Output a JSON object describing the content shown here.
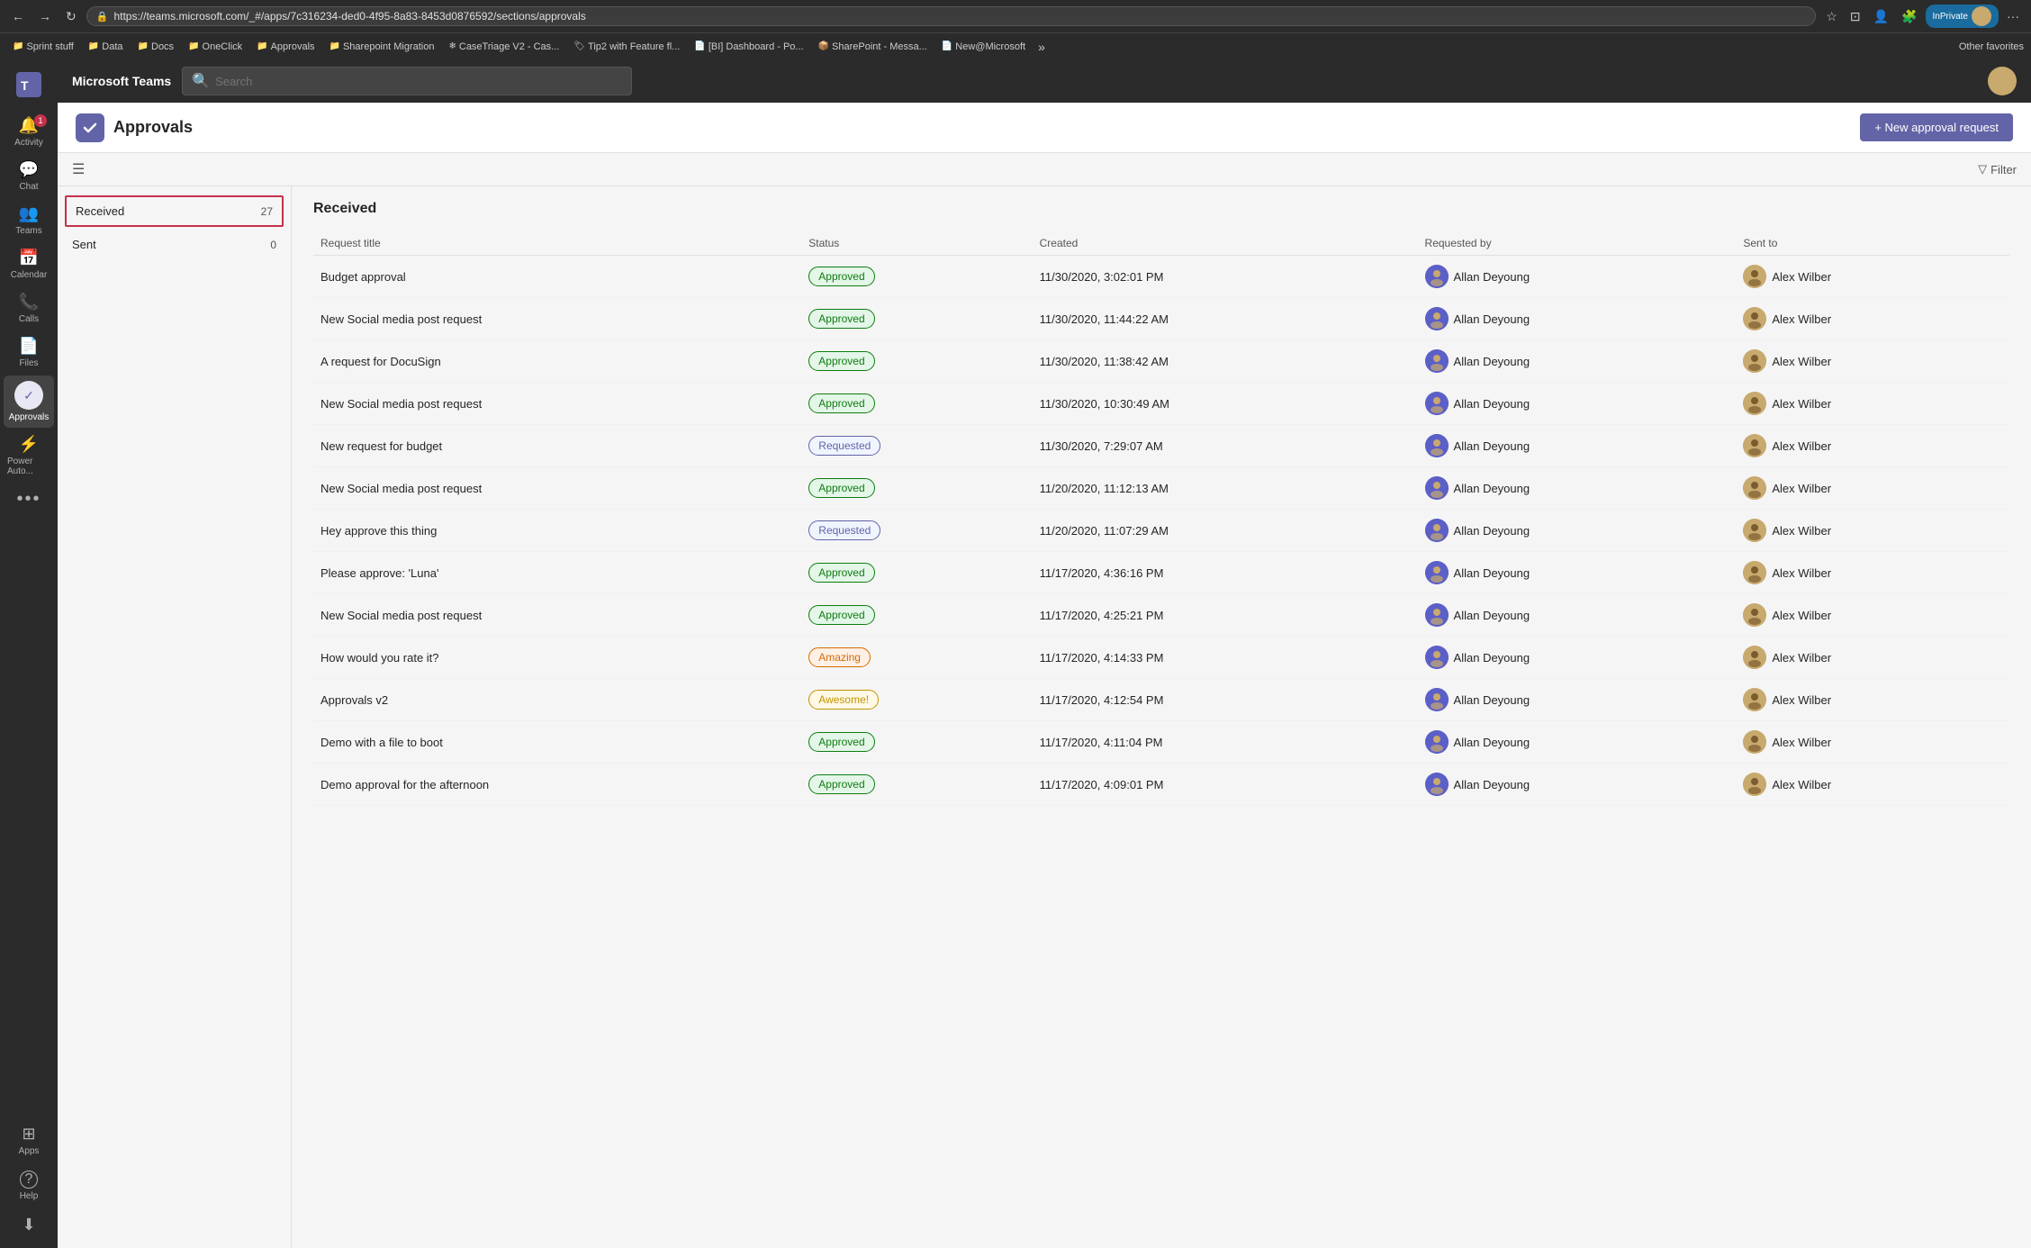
{
  "browser": {
    "url": "https://teams.microsoft.com/_#/apps/7c316234-ded0-4f95-8a83-8453d0876592/sections/approvals",
    "back_btn": "←",
    "forward_btn": "→",
    "refresh_btn": "↻",
    "bookmarks": [
      {
        "label": "Sprint stuff",
        "icon": "📁"
      },
      {
        "label": "Data",
        "icon": "📁"
      },
      {
        "label": "Docs",
        "icon": "📁"
      },
      {
        "label": "OneClick",
        "icon": "📁"
      },
      {
        "label": "Approvals",
        "icon": "📁"
      },
      {
        "label": "Sharepoint Migration",
        "icon": "📁"
      },
      {
        "label": "CaseTriage V2 - Cas...",
        "icon": "❄"
      },
      {
        "label": "Tip2 with Feature fl...",
        "icon": "🏷"
      },
      {
        "label": "[BI] Dashboard - Po...",
        "icon": "📄"
      },
      {
        "label": "SharePoint - Messa...",
        "icon": "📦"
      },
      {
        "label": "New@Microsoft",
        "icon": "📄"
      }
    ],
    "other_favorites": "Other favorites",
    "inprivate_label": "InPrivate"
  },
  "teams": {
    "app_name": "Microsoft Teams",
    "search_placeholder": "Search",
    "sidebar": {
      "items": [
        {
          "id": "activity",
          "label": "Activity",
          "icon": "🔔",
          "badge": "1"
        },
        {
          "id": "chat",
          "label": "Chat",
          "icon": "💬"
        },
        {
          "id": "teams",
          "label": "Teams",
          "icon": "👥"
        },
        {
          "id": "calendar",
          "label": "Calendar",
          "icon": "📅"
        },
        {
          "id": "calls",
          "label": "Calls",
          "icon": "📞"
        },
        {
          "id": "files",
          "label": "Files",
          "icon": "📄"
        },
        {
          "id": "approvals",
          "label": "Approvals",
          "icon": "✓",
          "active": true
        },
        {
          "id": "powerauto",
          "label": "Power Auto...",
          "icon": "⚡"
        },
        {
          "id": "more",
          "label": "...",
          "icon": "···"
        },
        {
          "id": "apps",
          "label": "Apps",
          "icon": "⊞"
        },
        {
          "id": "help",
          "label": "Help",
          "icon": "?"
        }
      ]
    }
  },
  "approvals": {
    "title": "Approvals",
    "new_button_label": "+ New approval request",
    "filter_label": "Filter",
    "section_title": "Received",
    "nav_items": [
      {
        "id": "received",
        "label": "Received",
        "count": "27",
        "active": true
      },
      {
        "id": "sent",
        "label": "Sent",
        "count": "0"
      }
    ],
    "columns": {
      "request_title": "Request title",
      "status": "Status",
      "created": "Created",
      "requested_by": "Requested by",
      "sent_to": "Sent to"
    },
    "rows": [
      {
        "title": "Budget approval",
        "status": "Approved",
        "status_type": "approved",
        "created": "11/30/2020, 3:02:01 PM",
        "requested_by": "Allan Deyoung",
        "sent_to": "Alex Wilber"
      },
      {
        "title": "New Social media post request",
        "status": "Approved",
        "status_type": "approved",
        "created": "11/30/2020, 11:44:22 AM",
        "requested_by": "Allan Deyoung",
        "sent_to": "Alex Wilber"
      },
      {
        "title": "A request for DocuSign",
        "status": "Approved",
        "status_type": "approved",
        "created": "11/30/2020, 11:38:42 AM",
        "requested_by": "Allan Deyoung",
        "sent_to": "Alex Wilber"
      },
      {
        "title": "New Social media post request",
        "status": "Approved",
        "status_type": "approved",
        "created": "11/30/2020, 10:30:49 AM",
        "requested_by": "Allan Deyoung",
        "sent_to": "Alex Wilber"
      },
      {
        "title": "New request for budget",
        "status": "Requested",
        "status_type": "requested",
        "created": "11/30/2020, 7:29:07 AM",
        "requested_by": "Allan Deyoung",
        "sent_to": "Alex Wilber"
      },
      {
        "title": "New Social media post request",
        "status": "Approved",
        "status_type": "approved",
        "created": "11/20/2020, 11:12:13 AM",
        "requested_by": "Allan Deyoung",
        "sent_to": "Alex Wilber"
      },
      {
        "title": "Hey approve this thing",
        "status": "Requested",
        "status_type": "requested",
        "created": "11/20/2020, 11:07:29 AM",
        "requested_by": "Allan Deyoung",
        "sent_to": "Alex Wilber"
      },
      {
        "title": "Please approve: 'Luna'",
        "status": "Approved",
        "status_type": "approved",
        "created": "11/17/2020, 4:36:16 PM",
        "requested_by": "Allan Deyoung",
        "sent_to": "Alex Wilber"
      },
      {
        "title": "New Social media post request",
        "status": "Approved",
        "status_type": "approved",
        "created": "11/17/2020, 4:25:21 PM",
        "requested_by": "Allan Deyoung",
        "sent_to": "Alex Wilber"
      },
      {
        "title": "How would you rate it?",
        "status": "Amazing",
        "status_type": "amazing",
        "created": "11/17/2020, 4:14:33 PM",
        "requested_by": "Allan Deyoung",
        "sent_to": "Alex Wilber"
      },
      {
        "title": "Approvals v2",
        "status": "Awesome!",
        "status_type": "awesome",
        "created": "11/17/2020, 4:12:54 PM",
        "requested_by": "Allan Deyoung",
        "sent_to": "Alex Wilber"
      },
      {
        "title": "Demo with a file to boot",
        "status": "Approved",
        "status_type": "approved",
        "created": "11/17/2020, 4:11:04 PM",
        "requested_by": "Allan Deyoung",
        "sent_to": "Alex Wilber"
      },
      {
        "title": "Demo approval for the afternoon",
        "status": "Approved",
        "status_type": "approved",
        "created": "11/17/2020, 4:09:01 PM",
        "requested_by": "Allan Deyoung",
        "sent_to": "Alex Wilber"
      }
    ]
  }
}
